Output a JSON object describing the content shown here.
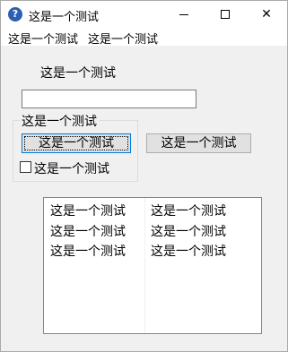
{
  "window": {
    "title": "这是一个测试",
    "icon": "question-icon",
    "icon_glyph": "?",
    "icon_color": "#2b5fb3"
  },
  "controls": {
    "minimize_icon": "minimize-icon",
    "maximize_icon": "maximize-icon",
    "close_icon": "close-icon",
    "close_glyph": "✕"
  },
  "menu": {
    "items": [
      "这是一个测试",
      "这是一个测试"
    ]
  },
  "form": {
    "label": "这是一个测试",
    "input_value": "",
    "group_title": "这是一个测试",
    "button_1": "这是一个测试",
    "button_2": "这是一个测试",
    "checkbox_label": "这是一个测试",
    "checkbox_checked": false,
    "focus_color": "#0078d7"
  },
  "list": {
    "rows": [
      [
        "这是一个测试",
        "这是一个测试"
      ],
      [
        "这是一个测试",
        "这是一个测试"
      ],
      [
        "这是一个测试",
        "这是一个测试"
      ]
    ]
  }
}
